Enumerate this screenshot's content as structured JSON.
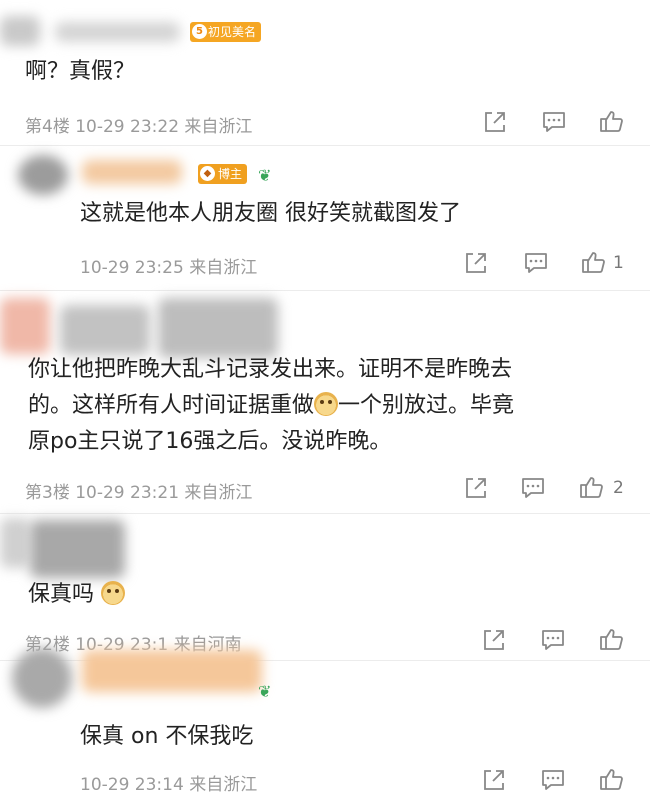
{
  "comments": [
    {
      "badge": {
        "level": "5",
        "label": "初见美名"
      },
      "text_lines": [
        "啊？真假？"
      ],
      "meta": "第4楼 10-29 23:22 来自浙江",
      "like_count": ""
    },
    {
      "badge": {
        "label": "博主"
      },
      "text_lines": [
        "这就是他本人朋友圈 很好笑就截图发了"
      ],
      "meta": "10-29 23:25 来自浙江",
      "like_count": "1"
    },
    {
      "text_lines": [
        "你让他把昨晚大乱斗记录发出来。证明不是昨晚去",
        "的。这样所有人时间证据重做",
        "一个别放过。毕竟",
        "原po主只说了16强之后。没说昨晚。"
      ],
      "meta": "第3楼 10-29 23:21 来自浙江",
      "like_count": "2"
    },
    {
      "text_lines": [
        "保真吗"
      ],
      "meta": "第2楼 10-29 23:1 来自河南",
      "like_count": ""
    },
    {
      "text_lines": [
        "保真 on 不保我吃"
      ],
      "meta": "10-29 23:14 来自浙江",
      "like_count": ""
    }
  ],
  "icons": {
    "share": "share-icon",
    "comment": "comment-icon",
    "like": "thumbs-up-icon"
  },
  "colors": {
    "badge_orange": "#f5a623",
    "blogger_badge": "#f0a020",
    "meta_gray": "#9a9a9a",
    "icon_gray": "#888888"
  }
}
